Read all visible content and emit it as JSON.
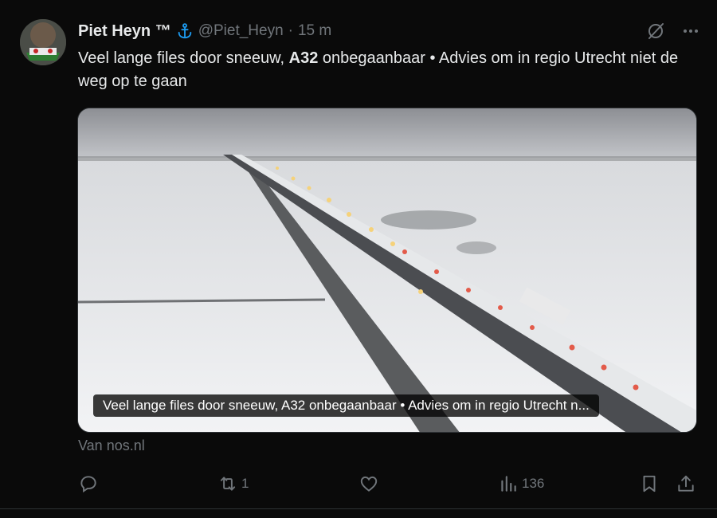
{
  "author": {
    "display_name": "Piet Heyn ™",
    "badge_icon": "anchor-icon",
    "handle": "@Piet_Heyn",
    "separator": "·",
    "time": "15 m"
  },
  "tweet": {
    "text_part1": "Veel lange files door sneeuw, ",
    "text_bold": "A32",
    "text_part2": " onbegaanbaar • Advies om in regio Utrecht niet de weg op te gaan"
  },
  "media": {
    "caption": "Veel lange files door sneeuw, A32 onbegaanbaar • Advies om in regio Utrecht n..."
  },
  "source": "Van nos.nl",
  "actions": {
    "reply_count": "",
    "retweet_count": "1",
    "like_count": "",
    "views_count": "136"
  },
  "colors": {
    "background": "#0a0a0a",
    "text": "#e7e9ea",
    "muted": "#71767b",
    "anchor_blue": "#1d9bf0"
  }
}
